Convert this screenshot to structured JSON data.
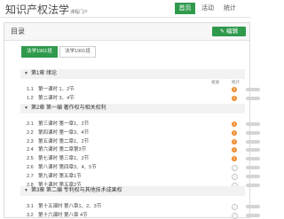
{
  "header": {
    "brand": "知识产权法学",
    "brand_sub": "课程门户",
    "nav": [
      "首页",
      "活动",
      "统计"
    ]
  },
  "panel": {
    "title": "目录",
    "edit_label": "编辑"
  },
  "tabs": [
    "法学1901班",
    "法学1901班"
  ],
  "columns": {
    "release": "发放",
    "stats": "统计"
  },
  "sections": [
    {
      "title": "第1章 绪论",
      "lessons": [
        {
          "num": "1.1",
          "title": "第一课时 1、2节",
          "status": "orange",
          "mark": "1"
        },
        {
          "num": "1.2",
          "title": "第二课时 3、4节",
          "status": "orange",
          "mark": "1"
        }
      ]
    },
    {
      "title": "第2章 第一编 著作权与相关权利",
      "lessons": [
        {
          "num": "2.1",
          "title": "第三课时 第一章1、2节",
          "status": "orange",
          "mark": "1"
        },
        {
          "num": "2.2",
          "title": "第四课时 第一章3、4节",
          "status": "orange",
          "mark": "1"
        },
        {
          "num": "2.3",
          "title": "第五课时 第二章1、2节",
          "status": "orange",
          "mark": "1"
        },
        {
          "num": "2.4",
          "title": "第六课时 第二章第3节",
          "status": "orange",
          "mark": "1"
        },
        {
          "num": "2.5",
          "title": "第七课时 第三章1、2节",
          "status": "orange",
          "mark": "1"
        },
        {
          "num": "2.6",
          "title": "第八课时 第四章3、4、5节",
          "status": "check",
          "mark": "✓"
        },
        {
          "num": "2.7",
          "title": "第九课时 第五章1节",
          "status": "check",
          "mark": "✓"
        },
        {
          "num": "2.8",
          "title": "第十课时 第五章2节",
          "status": "check",
          "mark": "✓"
        }
      ]
    },
    {
      "title": "第3章 第二编 专利权与其他技术成果权",
      "lessons": [
        {
          "num": "3.1",
          "title": "第十五课时 第八章1、2、3节",
          "status": "check",
          "mark": "✓"
        },
        {
          "num": "3.2",
          "title": "第十六课时 第八章 4节",
          "status": "check",
          "mark": "✓"
        }
      ]
    }
  ],
  "colors": {
    "accent": "#2f9a4c",
    "badge": "#ef8b2c"
  }
}
